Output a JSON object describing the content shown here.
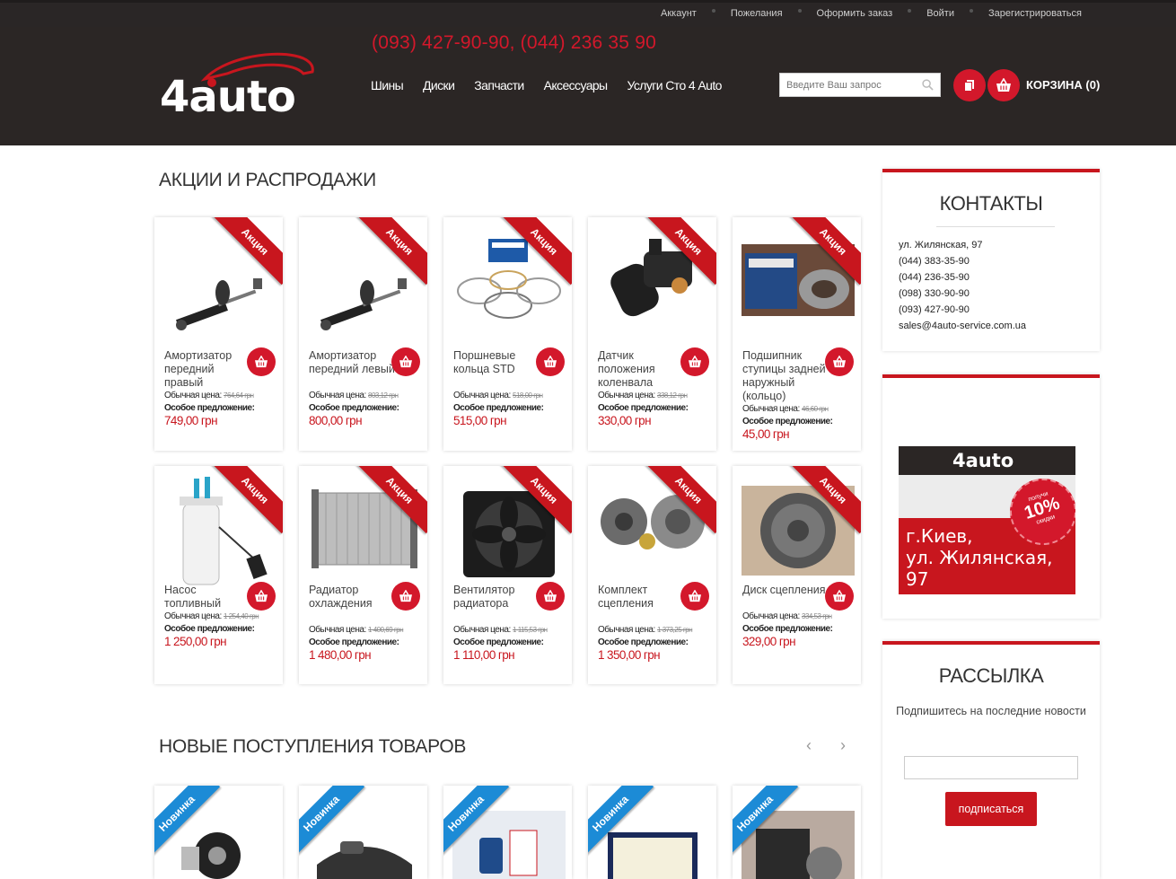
{
  "top_links": [
    "Аккаунт",
    "Пожелания",
    "Оформить заказ",
    "Войти",
    "Зарегистрироваться"
  ],
  "header": {
    "logo_text": "4auto",
    "phone": "(093) 427-90-90, (044) 236 35 90",
    "nav": [
      "Шины",
      "Диски",
      "Запчасти",
      "Аксессуары",
      "Услуги Сто 4 Auto"
    ],
    "search_placeholder": "Введите Ваш запрос",
    "cart_label": "КОРЗИНА (0)"
  },
  "promo": {
    "title": "АКЦИИ И РАСПРОДАЖИ",
    "ribbon": "Акция",
    "regular_label": "Обычная цена:",
    "special_label": "Особое предложение:",
    "products": [
      {
        "name": "Амортизатор передний правый",
        "old_price": "764,64 грн",
        "price": "749,00 грн",
        "icon": "shock-absorber"
      },
      {
        "name": "Амортизатор передний левый",
        "old_price": "803,12 грн",
        "price": "800,00 грн",
        "icon": "shock-absorber"
      },
      {
        "name": "Поршневые кольца STD",
        "old_price": "518,00 грн",
        "price": "515,00 грн",
        "icon": "piston-rings"
      },
      {
        "name": "Датчик положения коленвала",
        "old_price": "338,12 грн",
        "price": "330,00 грн",
        "icon": "sensor"
      },
      {
        "name": "Подшипник ступицы задней наружный (кольцо)",
        "old_price": "46,60 грн",
        "price": "45,00 грн",
        "icon": "bearing"
      },
      {
        "name": "Насос топливный",
        "old_price": "1 254,40 грн",
        "price": "1 250,00 грн",
        "icon": "fuel-pump"
      },
      {
        "name": "Радиатор охлаждения",
        "old_price": "1 400,69 грн",
        "price": "1 480,00 грн",
        "icon": "radiator"
      },
      {
        "name": "Вентилятор радиатора",
        "old_price": "1 115,53 грн",
        "price": "1 110,00 грн",
        "icon": "fan"
      },
      {
        "name": "Комплект сцепления",
        "old_price": "1 373,25 грн",
        "price": "1 350,00 грн",
        "icon": "clutch-kit"
      },
      {
        "name": "Диск сцепления",
        "old_price": "334,53 грн",
        "price": "329,00 грн",
        "icon": "clutch-disc"
      }
    ]
  },
  "new_arrivals": {
    "title": "НОВЫЕ ПОСТУПЛЕНИЯ ТОВАРОВ",
    "ribbon": "Новинка",
    "prev": "‹",
    "next": "›"
  },
  "contacts": {
    "title": "КОНТАКТЫ",
    "lines": [
      "ул. Жилянская, 97",
      "(044) 383-35-90",
      "(044) 236-35-90",
      "(098) 330-90-90",
      "(093) 427-90-90",
      "sales@4auto-service.com.ua"
    ]
  },
  "banner": {
    "logo": "4auto",
    "badge_top": "получи",
    "badge_value": "10%",
    "badge_bottom": "скидки",
    "city_line1": "г.Киев,",
    "city_line2": "ул. Жилянская, 97"
  },
  "newsletter": {
    "title": "РАССЫЛКА",
    "text": "Подпишитесь на последние новости",
    "button": "подписаться"
  },
  "colors": {
    "accent": "#c8161e",
    "header_bg": "#2b2625",
    "new_ribbon": "#1c8bd6"
  }
}
